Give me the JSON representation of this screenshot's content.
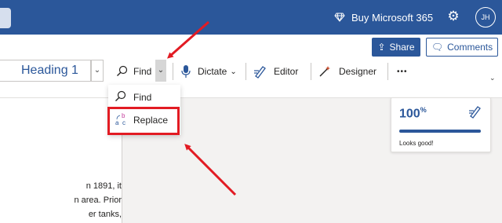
{
  "titlebar": {
    "buy_label": "Buy Microsoft 365",
    "avatar_initials": "JH"
  },
  "ribbon": {
    "share_label": "Share",
    "comments_label": "Comments",
    "style_value": "Heading 1",
    "find_label": "Find",
    "dictate_label": "Dictate",
    "editor_label": "Editor",
    "designer_label": "Designer",
    "more_label": "•••"
  },
  "dropdown": {
    "items": [
      {
        "label": "Find",
        "icon": "search-icon"
      },
      {
        "label": "Replace",
        "icon": "replace-icon"
      }
    ]
  },
  "document": {
    "lines": [
      "n 1891, it",
      "n area. Prior",
      "er tanks,"
    ]
  },
  "editor_card": {
    "score_value": "100",
    "score_unit": "%",
    "score_fraction": 1.0,
    "message": "Looks good!"
  },
  "colors": {
    "brand": "#2b579a",
    "annotation": "#e21b23"
  }
}
